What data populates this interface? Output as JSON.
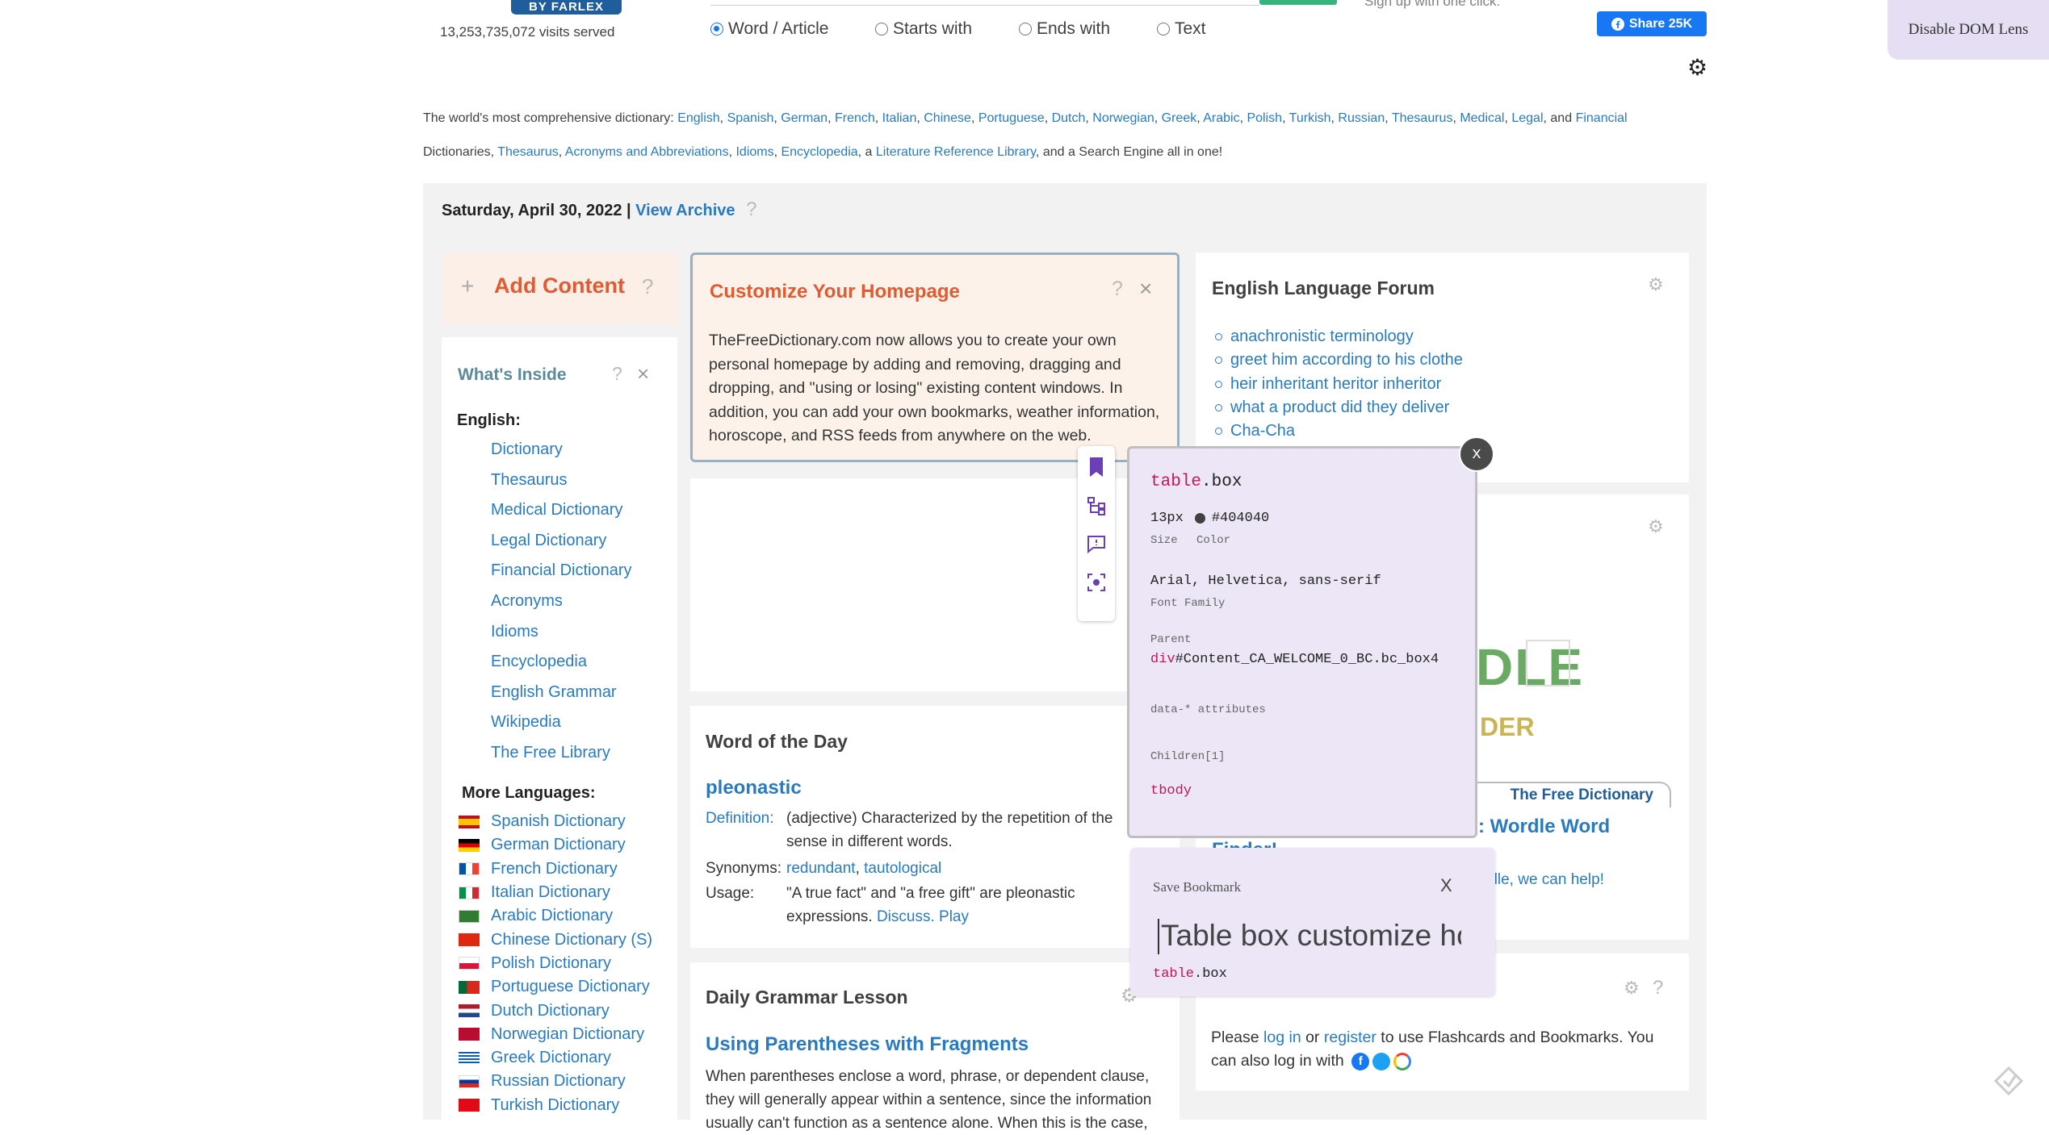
{
  "header": {
    "logo_text": "BY FARLEX",
    "visits": "13,253,735,072 visits served",
    "search_options": [
      {
        "label": "Word / Article",
        "selected": true
      },
      {
        "label": "Starts with",
        "selected": false
      },
      {
        "label": "Ends with",
        "selected": false
      },
      {
        "label": "Text",
        "selected": false
      }
    ],
    "signup_text": "Sign up with one click:",
    "share_label": "Share 25K",
    "dom_lens_label": "Disable DOM Lens"
  },
  "intro": {
    "prefix": "The world's most comprehensive dictionary: ",
    "line1_links": [
      "English",
      "Spanish",
      "German",
      "French",
      "Italian",
      "Chinese",
      "Portuguese",
      "Dutch",
      "Norwegian",
      "Greek",
      "Arabic",
      "Polish",
      "Turkish",
      "Russian",
      "Thesaurus",
      "Medical",
      "Legal"
    ],
    "and": "and",
    "financial": "Financial",
    "line2_start": "Dictionaries, ",
    "line2_links": [
      "Thesaurus",
      "Acronyms and Abbreviations",
      "Idioms",
      "Encyclopedia"
    ],
    "a_text": ", a ",
    "literature": "Literature Reference Library",
    "suffix": ", and a Search Engine all in one!"
  },
  "date_bar": {
    "date": "Saturday, April 30, 2022 |",
    "archive": "View Archive",
    "help": "?"
  },
  "add_content": {
    "label": "Add Content",
    "plus": "+",
    "help": "?"
  },
  "whats_inside": {
    "title": "What's Inside",
    "help": "?",
    "close": "×",
    "english_heading": "English:",
    "english_items": [
      "Dictionary",
      "Thesaurus",
      "Medical Dictionary",
      "Legal Dictionary",
      "Financial Dictionary",
      "Acronyms",
      "Idioms",
      "Encyclopedia",
      "English Grammar",
      "Wikipedia",
      "The Free Library"
    ],
    "languages_heading": "More Languages:",
    "languages": [
      {
        "label": "Spanish Dictionary",
        "flag": "es"
      },
      {
        "label": "German Dictionary",
        "flag": "de"
      },
      {
        "label": "French Dictionary",
        "flag": "fr"
      },
      {
        "label": "Italian Dictionary",
        "flag": "it"
      },
      {
        "label": "Arabic Dictionary",
        "flag": "ar"
      },
      {
        "label": "Chinese Dictionary (S)",
        "flag": "cn"
      },
      {
        "label": "Polish Dictionary",
        "flag": "pl"
      },
      {
        "label": "Portuguese Dictionary",
        "flag": "pt"
      },
      {
        "label": "Dutch Dictionary",
        "flag": "nl"
      },
      {
        "label": "Norwegian Dictionary",
        "flag": "no"
      },
      {
        "label": "Greek Dictionary",
        "flag": "gr"
      },
      {
        "label": "Russian Dictionary",
        "flag": "ru"
      },
      {
        "label": "Turkish Dictionary",
        "flag": "tr"
      }
    ]
  },
  "customize": {
    "title": "Customize Your Homepage",
    "help": "?",
    "close": "×",
    "body": "TheFreeDictionary.com now allows you to create your own personal homepage by adding and removing, dragging and dropping, and \"using or losing\" existing content windows. In addition, you can add your own bookmarks, weather information, horoscope, and RSS feeds from anywhere on the web."
  },
  "word_of_day": {
    "title": "Word of the Day",
    "word": "pleonastic",
    "definition_label": "Definition:",
    "definition": "(adjective) Characterized by the repetition of the sense in different words.",
    "synonyms_label": "Synonyms:",
    "synonyms": [
      "redundant",
      "tautological"
    ],
    "usage_label": "Usage:",
    "usage": "\"A true fact\" and \"a free gift\" are pleonastic expressions.",
    "discuss": "Discuss.",
    "play": "Play"
  },
  "grammar": {
    "title": "Daily Grammar Lesson",
    "subtitle": "Using Parentheses with Fragments",
    "body": "When parentheses enclose a word, phrase, or dependent clause, they will generally appear within a sentence, since the information usually can't function as a sentence alone. When this is the case,"
  },
  "forum": {
    "title": "English Language Forum",
    "items": [
      "anachronistic terminology",
      "greet him according to his clothe",
      "heir inheritant heritor inheritor",
      "what a product did they deliver",
      "Cha-Cha"
    ]
  },
  "wordle": {
    "logo_fragment": "DLE",
    "helper_fragment": "DER",
    "badge": "The Free Dictionary",
    "headline": ": Wordle Word",
    "finder": "Finder!",
    "help_text": "rdle, we can help!"
  },
  "flashcards": {
    "help": "?",
    "text_before": "Please ",
    "login": "log in",
    "or": " or ",
    "register": "register",
    "text_after": " to use Flashcards and Bookmarks. You can also log in with"
  },
  "inspector": {
    "tag": "table",
    "cls": ".box",
    "size": "13px",
    "color": "#404040",
    "size_label": "Size",
    "color_label": "Color",
    "font_family": "Arial, Helvetica, sans-serif",
    "font_family_label": "Font Family",
    "parent_label": "Parent",
    "parent_tag": "div",
    "parent_id": "#Content_CA_WELCOME_0_BC.bc_box4",
    "data_attrs_label": "data-* attributes",
    "children_label": "Children[1]",
    "child": "tbody",
    "close": "x"
  },
  "bookmark_panel": {
    "title": "Save Bookmark",
    "close": "X",
    "input_value": "Table box customize ho",
    "tag": "table",
    "cls": ".box"
  },
  "colors": {
    "link": "#2a7abf",
    "accent_orange": "#e05a32",
    "facebook": "#1877f2",
    "panel_purple": "#ece6f6",
    "tool_purple": "#6b3fb5"
  }
}
